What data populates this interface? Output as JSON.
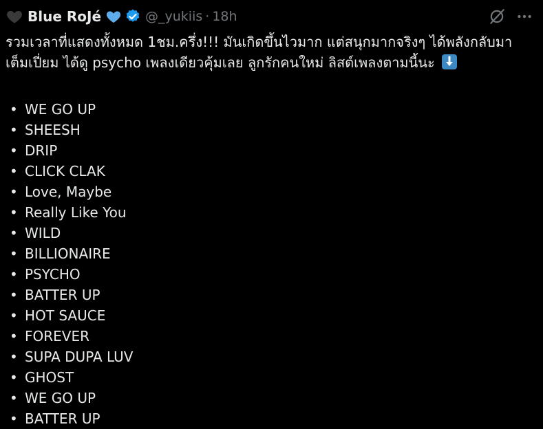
{
  "header": {
    "display_name": "Blue RoJé",
    "handle": "@_yukiis",
    "separator": "·",
    "time": "18h",
    "icons": {
      "left_emoji": "black-heart-icon",
      "name_emoji": "blue-heart-icon",
      "verified": "verified-badge-icon",
      "grok": "grok-icon",
      "more": "more-options-icon"
    },
    "colors": {
      "verified": "#1d9bf0",
      "blue_heart": "#5dadec",
      "muted": "#71767b"
    }
  },
  "tweet": {
    "line1": "รวมเวลาที่แสดงทั้งหมด 1ชม.ครึ่ง!!! มันเกิดขึ้นไวมาก แต่สนุกมากจริงๆ ได้พลังกลับมา",
    "line2": "เต็มเปี่ยม ได้ดู psycho เพลงเดียวคุ้มเลย ลูกรักคนใหม่ ลิสต์เพลงตามนี้นะ",
    "emoji": "down-arrow-emoji",
    "bullet": "•",
    "songs": [
      "WE GO UP",
      "SHEESH",
      "DRIP",
      "CLICK CLAK",
      "Love, Maybe",
      "Really Like You",
      "WILD",
      "BILLIONAIRE",
      "PSYCHO",
      "BATTER UP",
      "HOT SAUCE",
      "FOREVER",
      "SUPA DUPA LUV",
      "GHOST",
      "WE GO UP",
      "BATTER UP"
    ]
  }
}
